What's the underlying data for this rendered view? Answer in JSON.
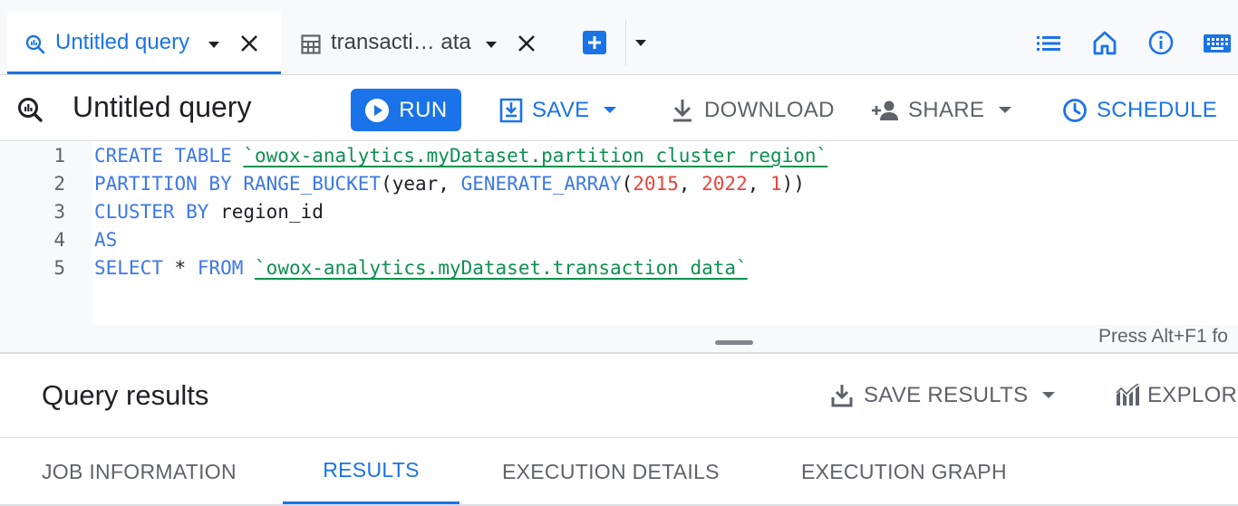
{
  "tabs": [
    {
      "label": "Untitled query",
      "icon": "query-icon",
      "active": true
    },
    {
      "label": "transacti… ata",
      "icon": "table-icon",
      "active": false
    }
  ],
  "tabbar_icons": [
    "add-tab-icon",
    "more-tabs-caret-icon",
    "list-icon",
    "home-icon",
    "info-icon",
    "keyboard-icon"
  ],
  "toolbar": {
    "title": "Untitled query",
    "run": "RUN",
    "save": "SAVE",
    "download": "DOWNLOAD",
    "share": "SHARE",
    "schedule": "SCHEDULE"
  },
  "editor": {
    "line_numbers": [
      "1",
      "2",
      "3",
      "4",
      "5"
    ],
    "hint": "Press Alt+F1 fo",
    "lines": [
      [
        {
          "t": "kw",
          "v": "CREATE TABLE "
        },
        {
          "t": "str",
          "v": "`owox-analytics.myDataset.partition_cluster_region`"
        }
      ],
      [
        {
          "t": "kw",
          "v": "PARTITION BY RANGE_BUCKET"
        },
        {
          "t": "plain",
          "v": "(year, "
        },
        {
          "t": "kw",
          "v": "GENERATE_ARRAY"
        },
        {
          "t": "plain",
          "v": "("
        },
        {
          "t": "num",
          "v": "2015"
        },
        {
          "t": "plain",
          "v": ", "
        },
        {
          "t": "num",
          "v": "2022"
        },
        {
          "t": "plain",
          "v": ", "
        },
        {
          "t": "num",
          "v": "1"
        },
        {
          "t": "plain",
          "v": "))"
        }
      ],
      [
        {
          "t": "kw",
          "v": "CLUSTER BY "
        },
        {
          "t": "plain",
          "v": "region_id"
        }
      ],
      [
        {
          "t": "kw",
          "v": "AS"
        }
      ],
      [
        {
          "t": "kw",
          "v": "SELECT "
        },
        {
          "t": "plain",
          "v": "* "
        },
        {
          "t": "kw",
          "v": "FROM "
        },
        {
          "t": "str",
          "v": "`owox-analytics.myDataset.transaction_data`"
        }
      ]
    ]
  },
  "results": {
    "title": "Query results",
    "save_results": "SAVE RESULTS",
    "explore": "EXPLORE",
    "tabs": [
      {
        "label": "JOB INFORMATION",
        "active": false
      },
      {
        "label": "RESULTS",
        "active": true
      },
      {
        "label": "EXECUTION DETAILS",
        "active": false
      },
      {
        "label": "EXECUTION GRAPH",
        "active": false
      }
    ]
  },
  "colors": {
    "accent": "#1a73e8",
    "keyword": "#3b78e7",
    "string": "#0d904f",
    "number": "#e8453c",
    "muted": "#5f6368"
  }
}
